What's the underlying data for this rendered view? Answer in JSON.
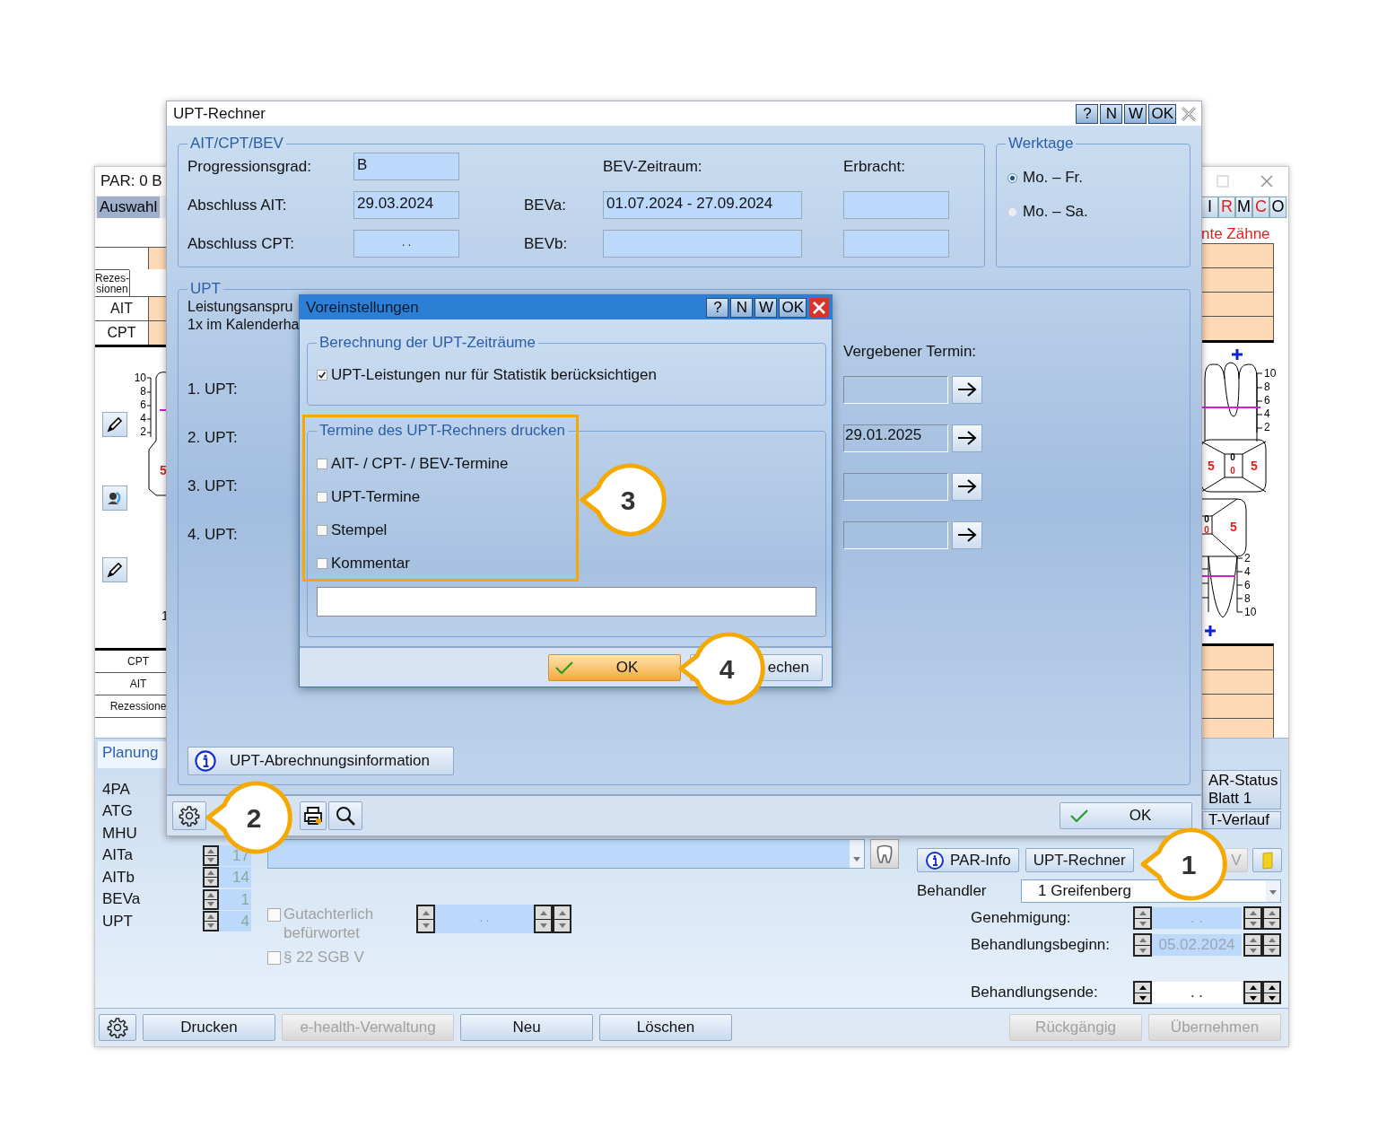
{
  "background_window": {
    "title": "PAR: 0  B",
    "tabs": [
      {
        "label": "Auswahl",
        "selected": true
      }
    ],
    "view_buttons": [
      {
        "label": "I",
        "color": "#000000"
      },
      {
        "label": "R",
        "color": "#e02020"
      },
      {
        "label": "M",
        "color": "#000000"
      },
      {
        "label": "C",
        "color": "#e02020"
      },
      {
        "label": "O",
        "color": "#000000"
      }
    ],
    "region_label": "nte Zähne",
    "left_table_rows": [
      "Rezes-\nsionen",
      "AIT",
      "CPT"
    ],
    "lower_table_rows": [
      "CPT",
      "AIT",
      "Rezessione"
    ],
    "left_scale": [
      "10",
      "8",
      "6",
      "4",
      "2"
    ],
    "left_tooth_mark": "5",
    "left_stub_label": "1",
    "right_scale_upper": [
      "10",
      "8",
      "6",
      "4",
      "2"
    ],
    "right_scale_lower": [
      "2",
      "4",
      "6",
      "8",
      "10"
    ],
    "right_upper_tooth_marks": [
      "5",
      "0",
      "0",
      "5"
    ],
    "right_lower_tooth_marks": [
      "0",
      "0",
      "5"
    ],
    "planning": {
      "tab": "Planung",
      "rows": [
        {
          "label": "4PA"
        },
        {
          "label": "ATG"
        },
        {
          "label": "MHU"
        },
        {
          "label": "AITa",
          "value": "17"
        },
        {
          "label": "AITb",
          "value": "14"
        },
        {
          "label": "BEVa",
          "value": "1"
        },
        {
          "label": "UPT",
          "value": "4"
        }
      ]
    },
    "options": [
      {
        "label": "Gutachterlich\nbefürwortet",
        "checked": false,
        "disabled": true
      },
      {
        "label": "§ 22 SGB V",
        "checked": false,
        "disabled": true
      }
    ],
    "opinion_date": ". .",
    "side_buttons": [
      "AR-Status\nBlatt 1",
      "T-Verlauf"
    ],
    "action_buttons": [
      {
        "label": "PAR-Info",
        "kind": "info"
      },
      {
        "label": "UPT-Rechner",
        "kind": "plain"
      },
      {
        "label": "V",
        "kind": "disabled"
      },
      {
        "kind": "note"
      }
    ],
    "behandler": {
      "label": "Behandler",
      "value": "1 Greifenberg"
    },
    "dates": [
      {
        "label": "Genehmigung:",
        "value": ". .",
        "disabled": true
      },
      {
        "label": "Behandlungsbeginn:",
        "value": "05.02.2024",
        "disabled": true
      },
      {
        "label": "Behandlungsende:",
        "value": ". .",
        "disabled": false
      }
    ],
    "footer_left": [
      {
        "label": "Drucken",
        "disabled": false
      },
      {
        "label": "e-health-Verwaltung",
        "disabled": true
      },
      {
        "label": "Neu",
        "disabled": false
      },
      {
        "label": "Löschen",
        "disabled": false
      }
    ],
    "footer_right": [
      {
        "label": "Rückgängig",
        "disabled": true
      },
      {
        "label": "Übernehmen",
        "disabled": true
      }
    ]
  },
  "upt_dialog": {
    "title": "UPT-Rechner",
    "title_buttons": [
      "?",
      "N",
      "W",
      "OK"
    ],
    "aitcpt": {
      "title": "AIT/CPT/BEV",
      "bev_header": "BEV-Zeitraum:",
      "done_header": "Erbracht:",
      "fields": [
        {
          "label": "Progressionsgrad:",
          "value": "B"
        },
        {
          "label": "Abschluss AIT:",
          "value": "29.03.2024"
        },
        {
          "label": "Abschluss CPT:",
          "value": ". ."
        }
      ],
      "bev_rows": [
        {
          "label": "BEVa:",
          "value": "01.07.2024 - 27.09.2024"
        },
        {
          "label": "BEVb:"
        }
      ]
    },
    "workdays": {
      "title": "Werktage",
      "options": [
        {
          "label": "Mo. – Fr.",
          "selected": true
        },
        {
          "label": "Mo. – Sa.",
          "selected": false
        }
      ]
    },
    "upt": {
      "title": "UPT",
      "entitlement_lines": [
        "Leistungsanspru",
        "1x im Kalenderha"
      ],
      "termin_header": "Vergebener Termin:",
      "rows": [
        {
          "label": "1. UPT:"
        },
        {
          "label": "2. UPT:",
          "termin": "29.01.2025"
        },
        {
          "label": "3. UPT:"
        },
        {
          "label": "4. UPT:"
        }
      ]
    },
    "info_button": "UPT-Abrechnungsinformation",
    "ok_button": "OK"
  },
  "settings_dialog": {
    "title": "Voreinstellungen",
    "title_buttons": [
      "?",
      "N",
      "W",
      "OK"
    ],
    "calc_group": {
      "title": "Berechnung der UPT-Zeiträume",
      "options": [
        {
          "label": "UPT-Leistungen nur für Statistik berücksichtigen",
          "checked": true
        }
      ]
    },
    "print_group": {
      "title": "Termine des UPT-Rechners drucken",
      "highlighted": true,
      "options": [
        {
          "label": "AIT- / CPT- / BEV-Termine",
          "checked": false
        },
        {
          "label": "UPT-Termine",
          "checked": false
        },
        {
          "label": "Stempel",
          "checked": false
        },
        {
          "label": "Kommentar",
          "checked": false
        }
      ]
    },
    "ok_button": "OK",
    "cancel_button": "echen"
  },
  "callouts": [
    "1",
    "2",
    "3",
    "4"
  ]
}
